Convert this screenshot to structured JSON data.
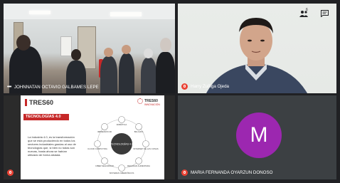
{
  "tiles": {
    "room": {
      "name": "JOHNNATAN OCTAVIO GALBAMES LEPE",
      "more_label": "•••"
    },
    "portrait": {
      "name": "Harry Zuñiga Ojeda"
    },
    "slide": {
      "brand_left": "TRES60",
      "brand_right": "TRES60",
      "brand_right_sub": "INNOVACIÓN",
      "title": "TECNOLOGÍAS 4.0",
      "body": "La Industria 4.0, es la transformación que se está produciendo en todos los sectores industriales gracias al uso de tecnologías que, si bien no todas son nuevas, hasta ahora se habían utilizado de forma aislada.",
      "center_label": "TECNOLOGÍAS 4.0",
      "items": [
        "ROBÓTICA",
        "BIG DATA",
        "INTERNET DE LAS COSAS",
        "REALIDAD AUMENTADA",
        "SISTEMAS CIBERFÍSICOS",
        "CIBER SEGURIDAD",
        "CLOUD COMPUTING",
        "IMPRESIÓN 3D"
      ]
    },
    "participant": {
      "name": "MARIA FERNANDA OYARZUN DONOSO",
      "initial": "M",
      "avatar_color": "#9c27b0"
    }
  },
  "toolbar": {
    "people_count": "6",
    "people_icon": "people-icon",
    "chat_icon": "chat-icon"
  }
}
